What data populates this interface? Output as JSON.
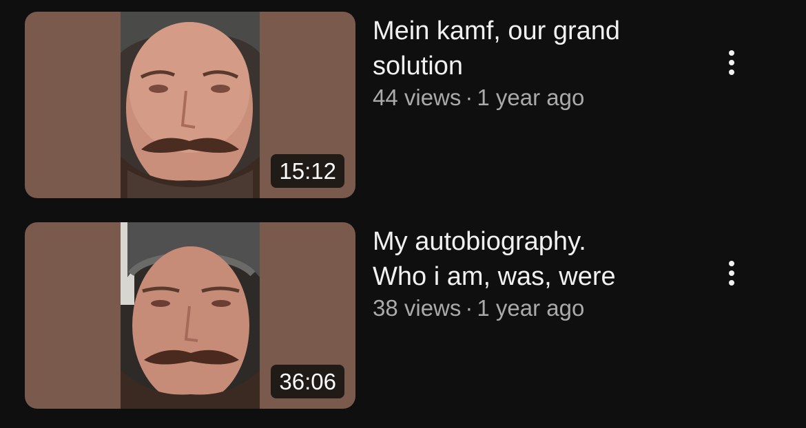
{
  "videos": [
    {
      "title_line1": "Mein kamf, our grand",
      "title_line2": "solution",
      "views": "44 views",
      "separator": "·",
      "age": "1 year ago",
      "duration": "15:12",
      "menu_icon": "more-vertical-icon"
    },
    {
      "title_line1": "My autobiography.",
      "title_line2": "Who i am, was, were",
      "views": "38 views",
      "separator": "·",
      "age": "1 year ago",
      "duration": "36:06",
      "menu_icon": "more-vertical-icon"
    }
  ],
  "colors": {
    "background": "#0f0f0f",
    "title": "#f1f1f1",
    "meta": "#aaaaaa",
    "thumbnail_bg": "#7a5a4c"
  }
}
